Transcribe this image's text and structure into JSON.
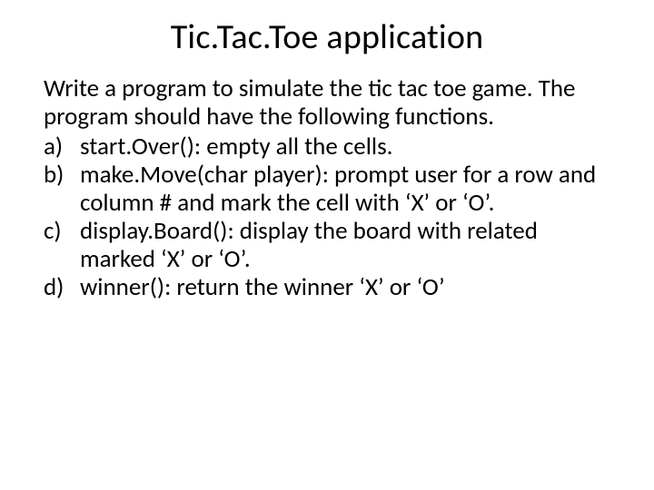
{
  "title": "Tic.Tac.Toe application",
  "intro": "Write a program to simulate the tic tac toe game. The program should have the following functions.",
  "items": [
    {
      "marker": "a)",
      "text": "start.Over():  empty all the cells."
    },
    {
      "marker": "b)",
      "text": "make.Move(char player): prompt user for a row and column # and mark the cell with ‘X’ or ‘O’."
    },
    {
      "marker": "c)",
      "text": "display.Board(): display the board with related marked ‘X’ or ‘O’."
    },
    {
      "marker": "d)",
      "text": "winner(): return the winner ‘X’ or ‘O’"
    }
  ]
}
